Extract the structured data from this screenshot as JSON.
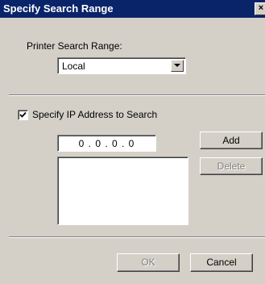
{
  "window": {
    "title": "Specify Search Range",
    "close_glyph": "×"
  },
  "search_range": {
    "label": "Printer Search Range:",
    "selected": "Local"
  },
  "ip_section": {
    "checkbox_label": "Specify IP Address to Search",
    "checked": true,
    "ip_value": "0 . 0 . 0 . 0",
    "address_list": []
  },
  "buttons": {
    "add": "Add",
    "delete": "Delete",
    "ok": "OK",
    "cancel": "Cancel"
  },
  "colors": {
    "title_bar": "#0a246a",
    "face": "#d4d0c8",
    "disabled_text": "#808080"
  }
}
